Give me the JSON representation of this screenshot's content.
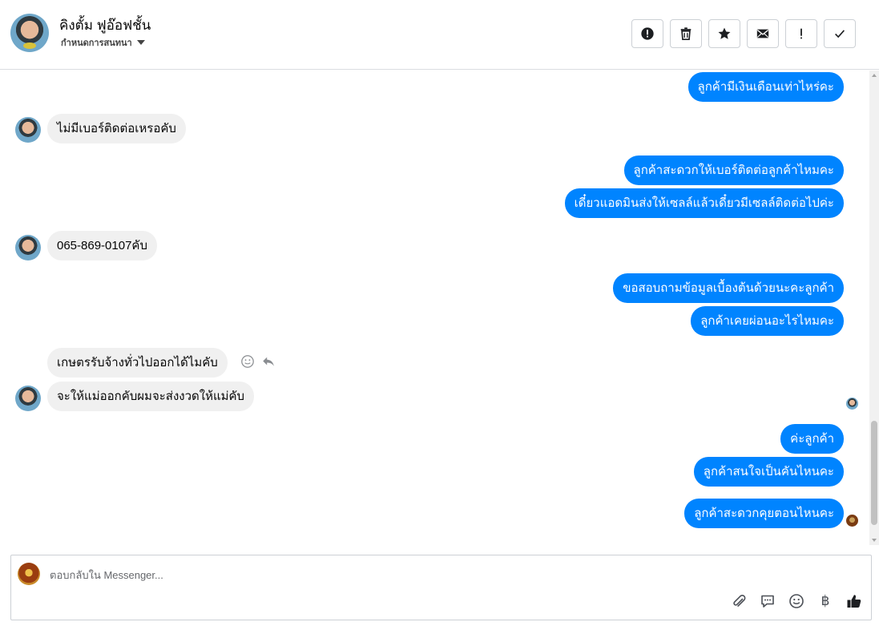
{
  "header": {
    "name": "คิงตั้ม ฟูอ๊อฟชั้น",
    "assign_label": "กำหนดการสนทนา",
    "toolbar": [
      {
        "name": "report-spam-button",
        "icon": "alert-circle-icon"
      },
      {
        "name": "delete-button",
        "icon": "trash-icon"
      },
      {
        "name": "star-button",
        "icon": "star-icon"
      },
      {
        "name": "mark-unread-button",
        "icon": "envelope-icon"
      },
      {
        "name": "follow-up-button",
        "icon": "exclamation-icon"
      },
      {
        "name": "mark-done-button",
        "icon": "check-icon"
      }
    ]
  },
  "messages": {
    "m1": "ลูกค้ามีเงินเดือนเท่าไหร่คะ",
    "m2": "ไม่มีเบอร์ติดต่อเหรอคับ",
    "m3": "ลูกค้าสะดวกให้เบอร์ติดต่อลูกค้าไหมคะ",
    "m4": "เดี๋ยวแอดมินส่งให้เซลล์แล้วเดี๋ยวมีเซลล์ติดต่อไปค่ะ",
    "m5": "065-869-0107คับ",
    "m6": "ขอสอบถามข้อมูลเบื้องต้นด้วยนะคะลูกค้า",
    "m7": "ลูกค้าเคยผ่อนอะไรไหมคะ",
    "m8": "เกษตรรับจ้างทั่วไปออกได้ไมคับ",
    "m9": "จะให้แม่ออกคับผมจะส่งงวดให้แม่คับ",
    "m10": "ค่ะลูกค้า",
    "m11": "ลูกค้าสนใจเป็นคันไหนคะ",
    "m12": "ลูกค้าสะดวกคุยตอนไหนคะ"
  },
  "composer": {
    "placeholder": "ตอบกลับใน Messenger...",
    "currency_symbol": "฿"
  },
  "colors": {
    "outgoing_bubble": "#0084ff",
    "incoming_bubble": "#f0f0f0"
  }
}
